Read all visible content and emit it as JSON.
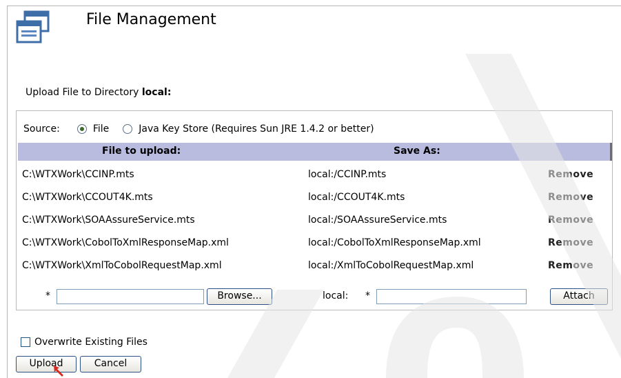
{
  "header": {
    "title": "File Management",
    "icon": "window-stack-icon"
  },
  "upload": {
    "label_prefix": "Upload File to Directory ",
    "directory": "local:"
  },
  "source": {
    "label": "Source:",
    "options": [
      {
        "label": "File",
        "selected": true
      },
      {
        "label": "Java Key Store (Requires Sun JRE 1.4.2 or better)",
        "selected": false
      }
    ]
  },
  "table": {
    "columns": [
      "File to upload:",
      "Save As:"
    ],
    "rows": [
      {
        "file": "C:\\WTXWork\\CCINP.mts",
        "save_as": "local:/CCINP.mts",
        "action": "Remove"
      },
      {
        "file": "C:\\WTXWork\\CCOUT4K.mts",
        "save_as": "local:/CCOUT4K.mts",
        "action": "Remove"
      },
      {
        "file": "C:\\WTXWork\\SOAAssureService.mts",
        "save_as": "local:/SOAAssureService.mts",
        "action": "Remove"
      },
      {
        "file": "C:\\WTXWork\\CobolToXmlResponseMap.xml",
        "save_as": "local:/CobolToXmlResponseMap.xml",
        "action": "Remove"
      },
      {
        "file": "C:\\WTXWork\\XmlToCobolRequestMap.xml",
        "save_as": "local:/XmlToCobolRequestMap.xml",
        "action": "Remove"
      }
    ]
  },
  "entry": {
    "required_marker": "*",
    "file_value": "",
    "browse_label": "Browse...",
    "save_prefix": "local:",
    "save_value": "",
    "attach_label": "Attach"
  },
  "options": {
    "overwrite_label": "Overwrite Existing Files",
    "overwrite_checked": false
  },
  "actions": {
    "upload_label": "Upload",
    "cancel_label": "Cancel"
  },
  "colors": {
    "table_header": "#b9bcdf",
    "button_border": "#2d4f86",
    "pointer": "#d62a1e"
  }
}
